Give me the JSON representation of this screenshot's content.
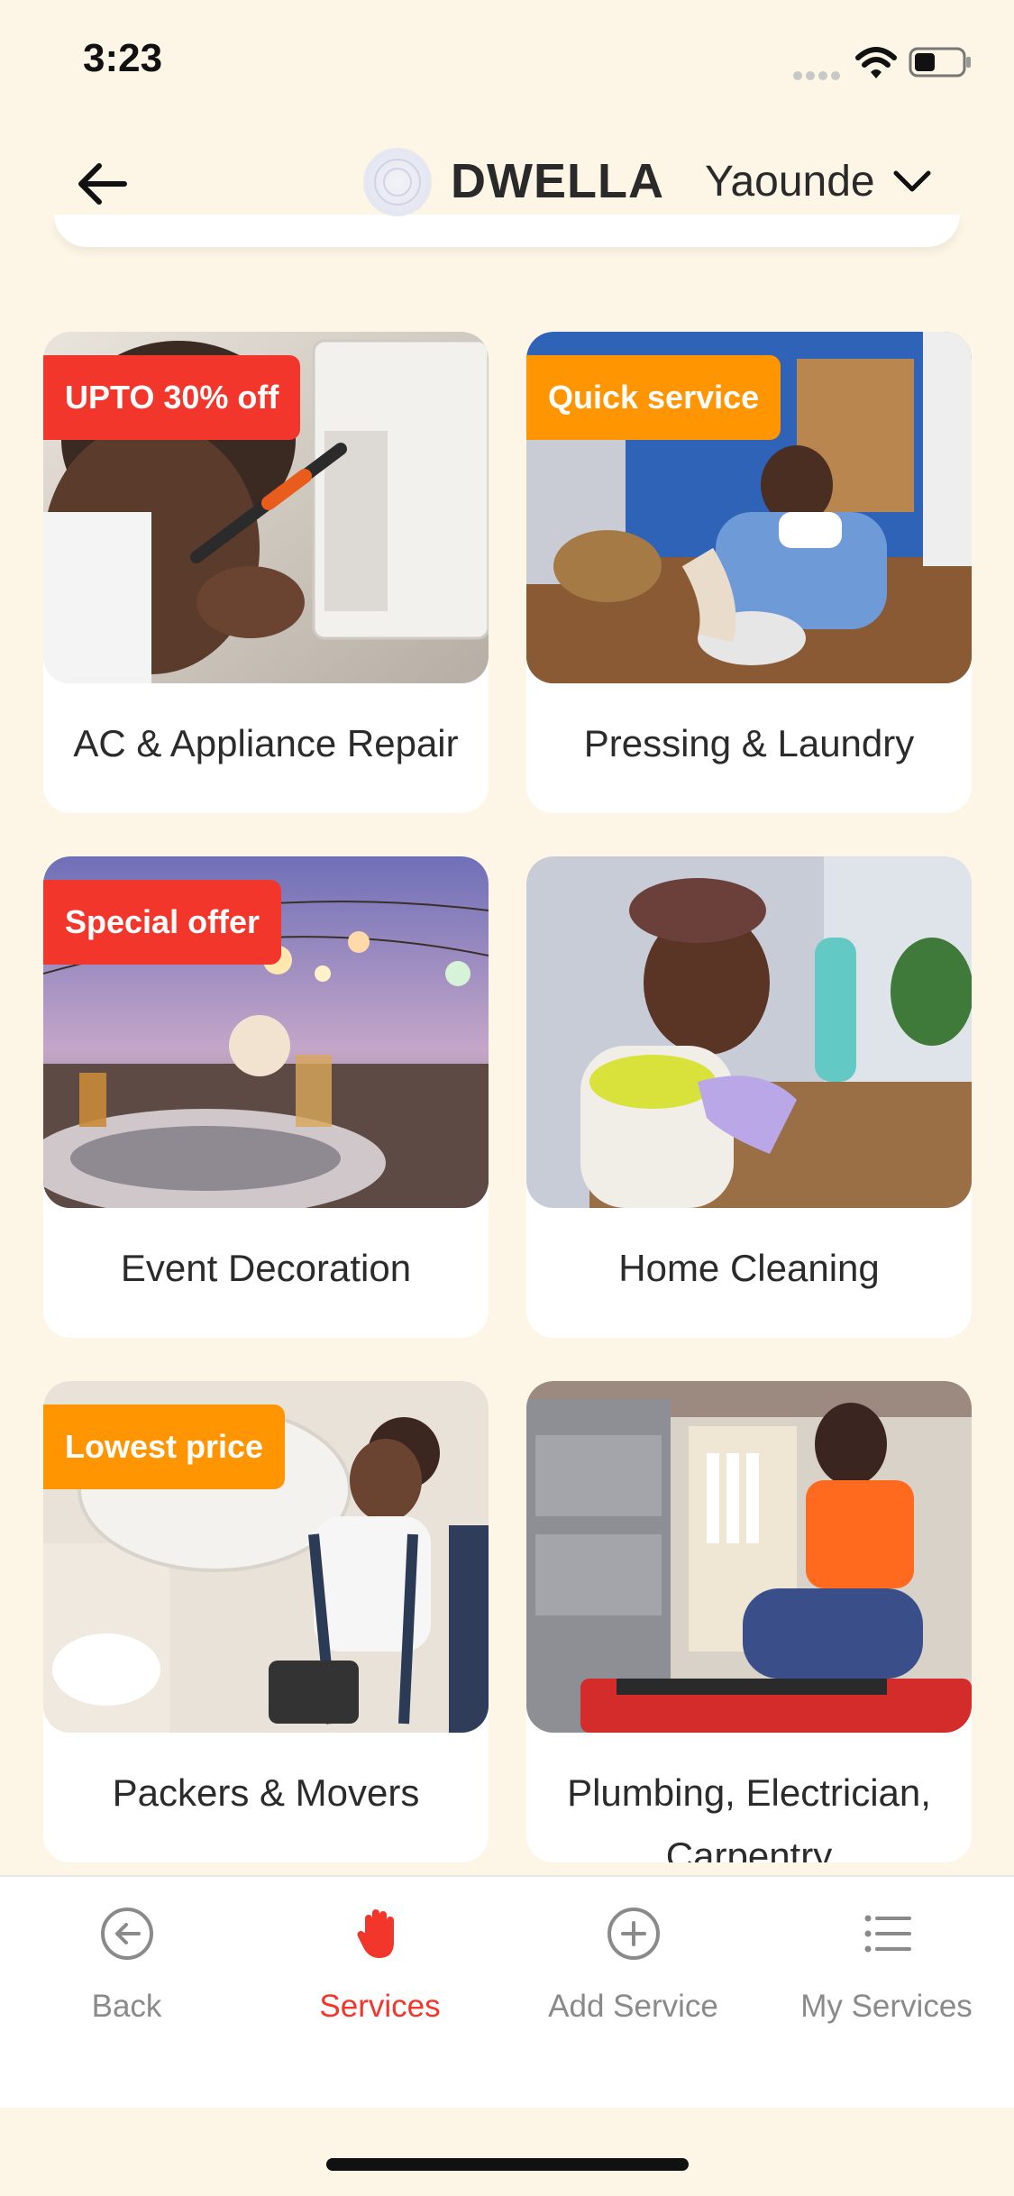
{
  "status": {
    "time": "3:23"
  },
  "header": {
    "brand": "DWELLA",
    "city": "Yaounde"
  },
  "services": [
    {
      "title": "AC & Appliance Repair",
      "badge": "UPTO 30% off",
      "badge_color": "#f2362b",
      "image": "ac-repair-photo"
    },
    {
      "title": "Pressing & Laundry",
      "badge": "Quick service",
      "badge_color": "#ff9500",
      "image": "laundry-photo"
    },
    {
      "title": "Event Decoration",
      "badge": "Special offer",
      "badge_color": "#f2362b",
      "image": "event-decoration-photo"
    },
    {
      "title": "Home Cleaning",
      "badge": "",
      "image": "home-cleaning-photo"
    },
    {
      "title": "Packers & Movers",
      "badge": "Lowest price",
      "badge_color": "#ff9500",
      "image": "packers-movers-photo"
    },
    {
      "title": "Plumbing, Electrician, Carpentry",
      "badge": "",
      "image": "plumbing-photo"
    }
  ],
  "tabbar": {
    "items": [
      {
        "label": "Back",
        "icon": "arrow-left-circle-icon",
        "active": false
      },
      {
        "label": "Services",
        "icon": "hand-icon",
        "active": true
      },
      {
        "label": "Add Service",
        "icon": "plus-circle-icon",
        "active": false
      },
      {
        "label": "My Services",
        "icon": "list-icon",
        "active": false
      }
    ]
  },
  "colors": {
    "accent": "#f2362b",
    "badge_orange": "#ff9500",
    "background": "#fdf6e6"
  }
}
